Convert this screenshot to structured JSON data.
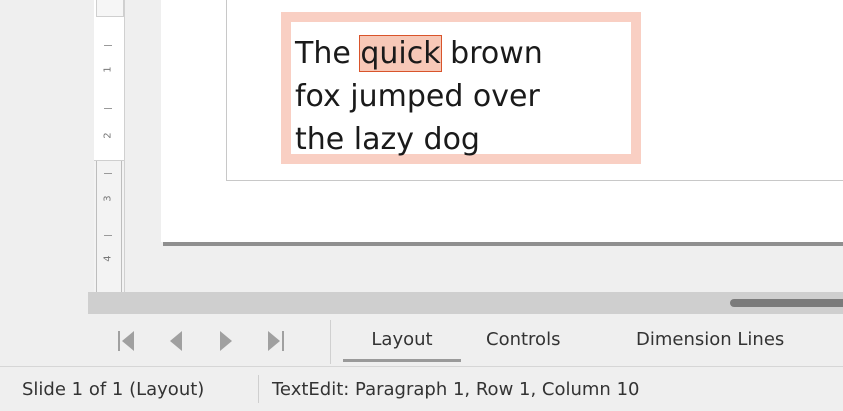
{
  "ruler": {
    "numbers": [
      "1",
      "2",
      "3",
      "4"
    ]
  },
  "textbox": {
    "before": "The ",
    "highlight": "quick",
    "after_line1": " brown",
    "line2": "fox jumped over",
    "line3": "the lazy dog"
  },
  "navigation": {
    "icons": [
      "first-slide-icon",
      "previous-slide-icon",
      "next-slide-icon",
      "last-slide-icon"
    ]
  },
  "tabs": [
    {
      "label": "Layout",
      "active": true
    },
    {
      "label": "Controls",
      "active": false
    },
    {
      "label": "Dimension Lines",
      "active": false
    }
  ],
  "status": {
    "slide": "Slide 1 of 1 (Layout)",
    "edit": "TextEdit: Paragraph 1, Row 1, Column 10"
  },
  "colors": {
    "highlight_fill": "#f7c8b7",
    "highlight_border": "#d9542b",
    "frame": "#f9cfc3"
  }
}
